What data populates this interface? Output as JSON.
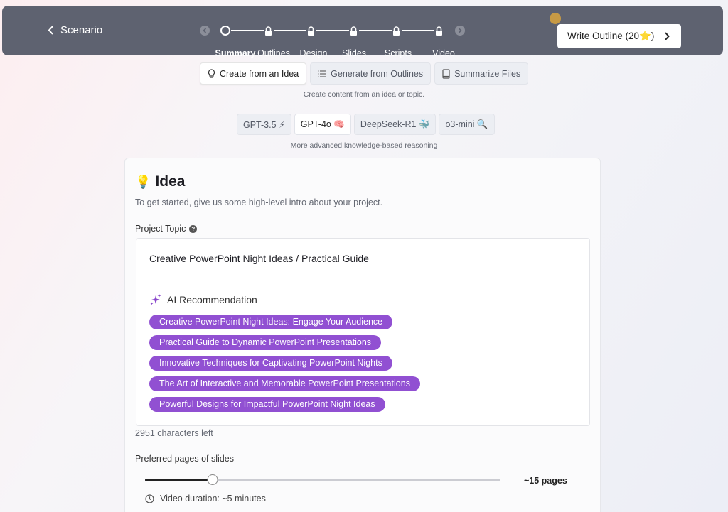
{
  "header": {
    "back_label": "Scenario",
    "write_button_label": "Write Outline (20⭐)",
    "steps": [
      {
        "label": "Summary",
        "state": "current"
      },
      {
        "label": "Outlines",
        "state": "locked"
      },
      {
        "label": "Design",
        "state": "locked"
      },
      {
        "label": "Slides",
        "state": "locked"
      },
      {
        "label": "Scripts",
        "state": "locked"
      },
      {
        "label": "Video",
        "state": "locked"
      }
    ]
  },
  "modes": {
    "items": [
      {
        "label": "Create from an Idea",
        "icon": "lightbulb-icon",
        "active": true
      },
      {
        "label": "Generate from Outlines",
        "icon": "list-icon",
        "active": false
      },
      {
        "label": "Summarize Files",
        "icon": "book-icon",
        "active": false
      }
    ],
    "caption": "Create content from an idea or topic."
  },
  "models": {
    "items": [
      {
        "label": "GPT-3.5 ⚡",
        "active": false
      },
      {
        "label": "GPT-4o 🧠",
        "active": true
      },
      {
        "label": "DeepSeek-R1 🐳",
        "active": false
      },
      {
        "label": "o3-mini 🔍",
        "active": false
      }
    ],
    "caption": "More advanced knowledge-based reasoning"
  },
  "idea": {
    "icon": "💡",
    "title": "Idea",
    "intro": "To get started, give us some high-level intro about your project.",
    "topic_label": "Project Topic",
    "topic_value": "Creative PowerPoint Night Ideas / Practical Guide",
    "ai_label": "AI Recommendation",
    "recommendations": [
      "Creative PowerPoint Night Ideas: Engage Your Audience",
      "Practical Guide to Dynamic PowerPoint Presentations",
      "Innovative Techniques for Captivating PowerPoint Nights",
      "The Art of Interactive and Memorable PowerPoint Presentations",
      "Powerful Designs for Impactful PowerPoint Night Ideas"
    ],
    "chars_left": "2951 characters left",
    "pages_label": "Preferred pages of slides",
    "pages_value": "~15 pages",
    "slider_fraction": 0.19,
    "duration": "Video duration: ~5 minutes"
  },
  "colors": {
    "topbar": "#5e6270",
    "chip": "#9150d2",
    "accent_dot": "#c79a45"
  }
}
